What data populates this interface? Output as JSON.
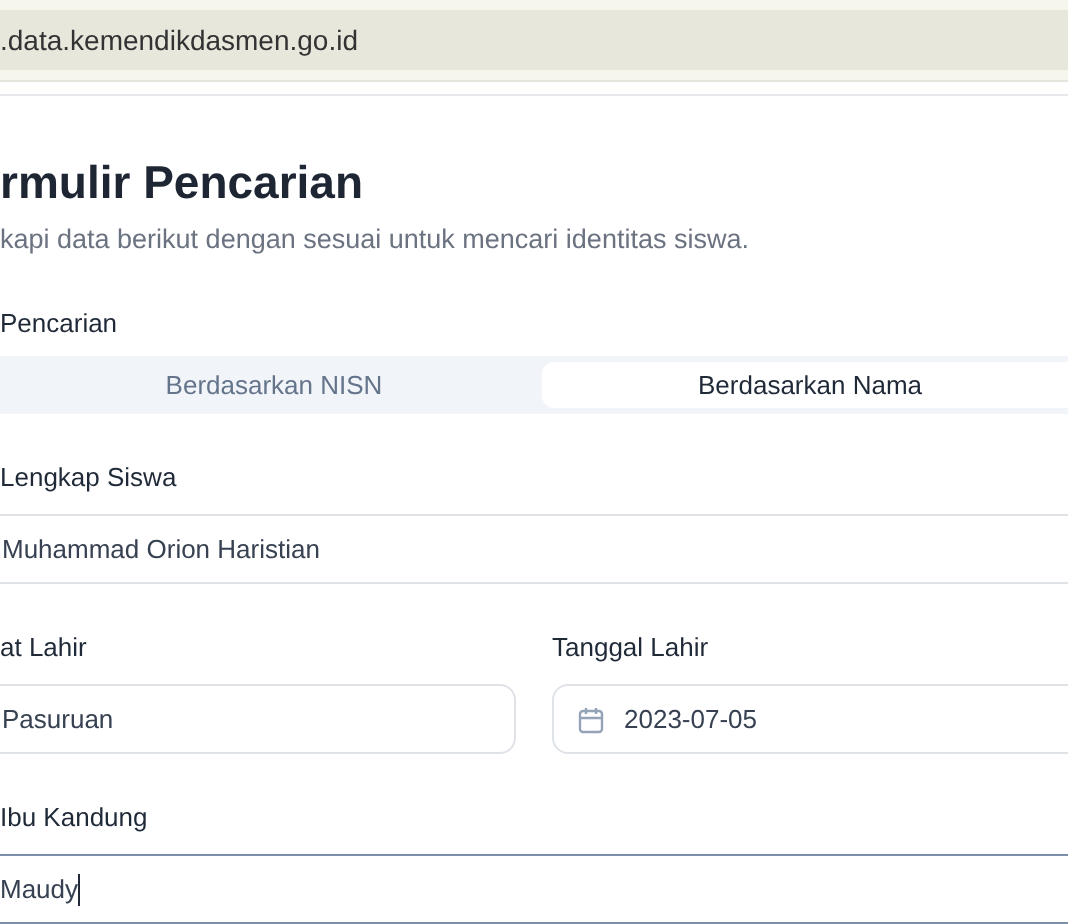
{
  "address_bar": {
    "url": ".data.kemendikdasmen.go.id"
  },
  "form": {
    "title": "rmulir Pencarian",
    "subtitle": "kapi data berikut dengan sesuai untuk mencari identitas siswa.",
    "mode_label": "Pencarian",
    "tabs": [
      {
        "label": "Berdasarkan NISN",
        "selected": false
      },
      {
        "label": "Berdasarkan Nama",
        "selected": true
      }
    ],
    "rows": [
      [
        {
          "kind": "text",
          "label": "Lengkap Siswa",
          "value": "Muhammad Orion Haristian",
          "focused": false
        }
      ],
      [
        {
          "kind": "text",
          "label": "at Lahir",
          "value": "Pasuruan",
          "focused": false
        },
        {
          "kind": "date",
          "label": "Tanggal Lahir",
          "value": "2023-07-05",
          "focused": false
        }
      ],
      [
        {
          "kind": "text",
          "label": "Ibu Kandung",
          "value": "Maudy",
          "focused": true
        }
      ]
    ]
  }
}
